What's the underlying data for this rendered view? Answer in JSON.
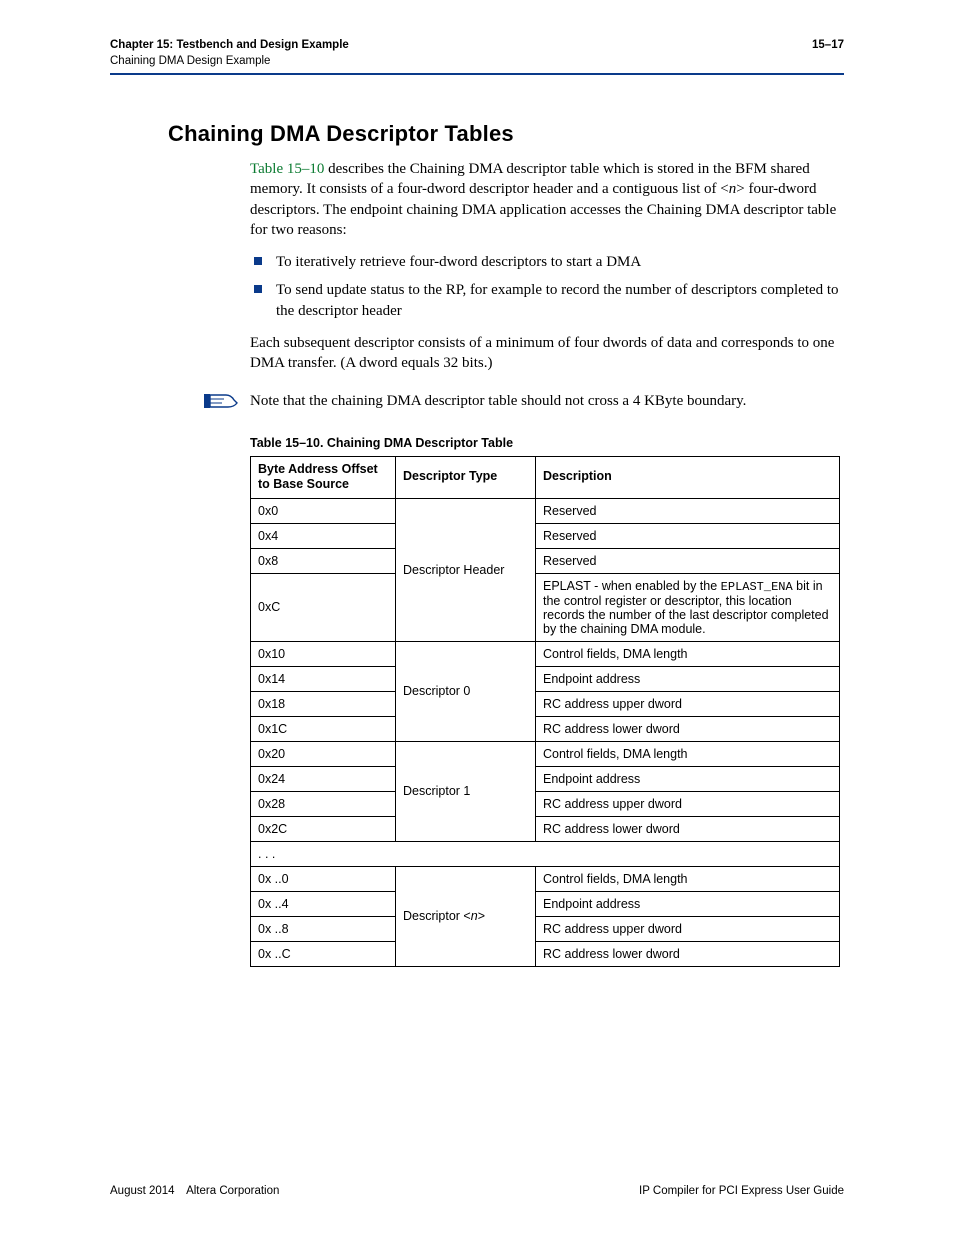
{
  "header": {
    "chapter_line": "Chapter 15: Testbench and Design Example",
    "sub_line": "Chaining DMA Design Example",
    "page_num": "15–17"
  },
  "heading": "Chaining DMA Descriptor Tables",
  "intro": {
    "link_text": "Table 15–10",
    "rest1": " describes the Chaining DMA descriptor table which is stored in the BFM shared memory. It consists of a four-dword descriptor header and a contiguous list of <",
    "n": "n",
    "rest2": "> four-dword descriptors. The endpoint chaining DMA application accesses the Chaining DMA descriptor table for two reasons:"
  },
  "bullets": [
    "To iteratively retrieve four-dword descriptors to start a DMA",
    "To send update status to the RP, for example to record the number of descriptors completed to the descriptor header"
  ],
  "para2": "Each subsequent descriptor consists of a minimum of four dwords of data and corresponds to one DMA transfer. (A dword equals 32 bits.)",
  "note": "Note that the chaining DMA descriptor table should not cross a 4 KByte boundary.",
  "table": {
    "caption": "Table 15–10. Chaining DMA Descriptor Table",
    "headers": {
      "c1": "Byte Address Offset to Base Source",
      "c2": "Descriptor Type",
      "c3": "Description"
    },
    "groups": [
      {
        "type": "Descriptor Header",
        "rows": [
          {
            "offset": "0x0",
            "desc": "Reserved"
          },
          {
            "offset": "0x4",
            "desc": "Reserved"
          },
          {
            "offset": "0x8",
            "desc": "Reserved"
          },
          {
            "offset": "0xC",
            "desc_pre": "EPLAST - when enabled by the ",
            "desc_mono": "EPLAST_ENA",
            "desc_post": " bit in the control register or descriptor, this location records the number of the last descriptor completed by the chaining DMA module."
          }
        ]
      },
      {
        "type": "Descriptor 0",
        "rows": [
          {
            "offset": "0x10",
            "desc": "Control fields, DMA length"
          },
          {
            "offset": "0x14",
            "desc": "Endpoint address"
          },
          {
            "offset": "0x18",
            "desc": "RC address upper dword"
          },
          {
            "offset": "0x1C",
            "desc": "RC address lower dword"
          }
        ]
      },
      {
        "type": "Descriptor 1",
        "rows": [
          {
            "offset": "0x20",
            "desc": "Control fields, DMA length"
          },
          {
            "offset": "0x24",
            "desc": "Endpoint address"
          },
          {
            "offset": "0x28",
            "desc": "RC address upper dword"
          },
          {
            "offset": "0x2C",
            "desc": "RC address lower dword"
          }
        ]
      }
    ],
    "ellipsis": ". . .",
    "group_n": {
      "type_pre": "Descriptor <",
      "type_n": "n",
      "type_post": ">",
      "rows": [
        {
          "offset": "0x ..0",
          "desc": "Control fields, DMA length"
        },
        {
          "offset": "0x ..4",
          "desc": "Endpoint address"
        },
        {
          "offset": "0x ..8",
          "desc": "RC address upper dword"
        },
        {
          "offset": "0x ..C",
          "desc": "RC address lower dword"
        }
      ]
    }
  },
  "footer": {
    "left": "August 2014 Altera Corporation",
    "right": "IP Compiler for PCI Express User Guide"
  }
}
